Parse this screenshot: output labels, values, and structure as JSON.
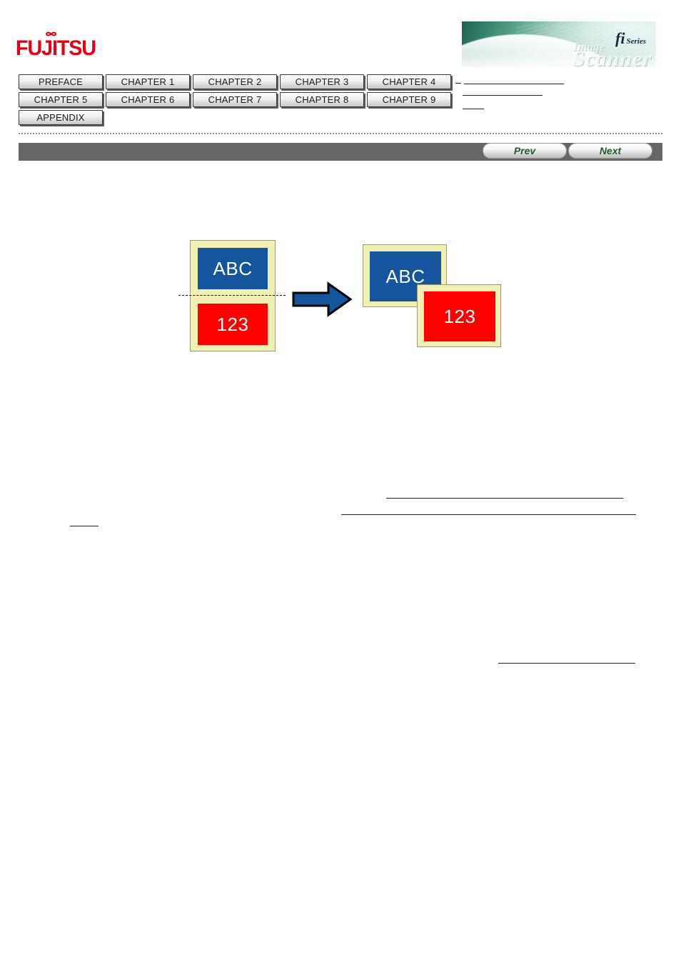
{
  "header": {
    "logo": {
      "name": "FUJITSU",
      "icon": "fujitsu-infinity-icon",
      "color": "#e60012"
    },
    "banner": {
      "product_mark": "fi",
      "product_series": "Series",
      "watermark_image": "Image",
      "watermark_scanner": "Scanner",
      "accent_color": "#2a6e5a"
    }
  },
  "chapter_nav": {
    "rows": [
      [
        {
          "label": "PREFACE"
        },
        {
          "label": "CHAPTER 1"
        },
        {
          "label": "CHAPTER 2"
        },
        {
          "label": "CHAPTER 3"
        },
        {
          "label": "CHAPTER 4"
        }
      ],
      [
        {
          "label": "CHAPTER 5"
        },
        {
          "label": "CHAPTER 6"
        },
        {
          "label": "CHAPTER 7"
        },
        {
          "label": "CHAPTER 8"
        },
        {
          "label": "CHAPTER 9"
        }
      ],
      [
        {
          "label": "APPENDIX"
        }
      ]
    ]
  },
  "toolbar": {
    "prev_label": "Prev",
    "next_label": "Next",
    "bar_color": "#666666",
    "link_color": "#1f5c28"
  },
  "diagram": {
    "title": "",
    "source_page": {
      "top_box_label": "ABC",
      "bottom_box_label": "123",
      "fold_line": "dashed",
      "sheet_color": "#f0f0b4",
      "top_box_color": "#15559e",
      "bottom_box_color": "#fe0000"
    },
    "arrow": {
      "icon": "right-arrow-icon",
      "color": "#15559e"
    },
    "result_pages": [
      {
        "label": "ABC",
        "box_color": "#15559e"
      },
      {
        "label": "123",
        "box_color": "#fe0000"
      }
    ]
  }
}
